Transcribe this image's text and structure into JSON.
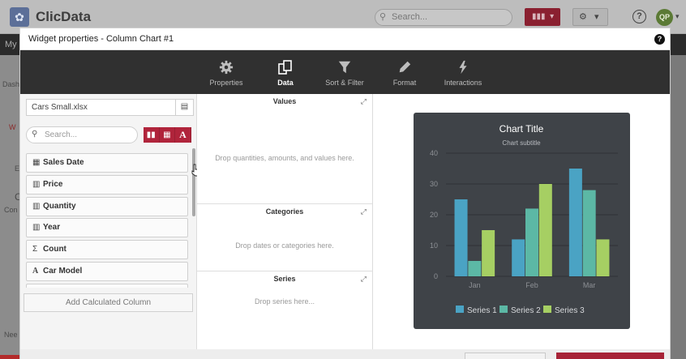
{
  "app": {
    "name": "ClicData",
    "search_placeholder": "Search...",
    "nav_fragment": "My",
    "avatar_initials": "QP",
    "left_fragments": [
      "Dash",
      "W",
      "E",
      "C",
      "Con"
    ],
    "bottom_fragment": "Nee",
    "accent": "#b0243b"
  },
  "modal": {
    "title": "Widget properties - Column Chart #1",
    "help": "?",
    "tabs": [
      {
        "label": "Properties",
        "icon": "gear-icon",
        "active": false
      },
      {
        "label": "Data",
        "icon": "data-icon",
        "active": true
      },
      {
        "label": "Sort & Filter",
        "icon": "filter-icon",
        "active": false
      },
      {
        "label": "Format",
        "icon": "pencil-icon",
        "active": false
      },
      {
        "label": "Interactions",
        "icon": "lightning-icon",
        "active": false
      }
    ]
  },
  "left": {
    "file_name": "Cars Small.xlsx",
    "search_placeholder": "Search...",
    "fields": [
      {
        "label": "Sales Date",
        "icon": "calendar-icon"
      },
      {
        "label": "Price",
        "icon": "bar-chart-icon"
      },
      {
        "label": "Quantity",
        "icon": "bar-chart-icon"
      },
      {
        "label": "Year",
        "icon": "bar-chart-icon"
      },
      {
        "label": "Count",
        "icon": "sigma-icon"
      },
      {
        "label": "Car Model",
        "icon": "text-icon"
      }
    ],
    "calc_button": "Add Calculated Column"
  },
  "drop_zones": {
    "values": {
      "title": "Values",
      "hint": "Drop quantities, amounts, and values here."
    },
    "categories": {
      "title": "Categories",
      "hint": "Drop dates or categories here."
    },
    "series": {
      "title": "Series",
      "hint": "Drop series here..."
    }
  },
  "chart_data": {
    "type": "bar",
    "title": "Chart Title",
    "subtitle": "Chart subtitle",
    "categories": [
      "Jan",
      "Feb",
      "Mar"
    ],
    "series": [
      {
        "name": "Series 1",
        "values": [
          25,
          12,
          35
        ],
        "color": "#4aa3c4"
      },
      {
        "name": "Series 2",
        "values": [
          5,
          22,
          28
        ],
        "color": "#5cb8a5"
      },
      {
        "name": "Series 3",
        "values": [
          15,
          30,
          12
        ],
        "color": "#a6cf63"
      }
    ],
    "ylim": [
      0,
      40
    ],
    "yticks": [
      "0",
      "10",
      "20",
      "30",
      "40"
    ],
    "grid": true,
    "legend": "bottom"
  }
}
